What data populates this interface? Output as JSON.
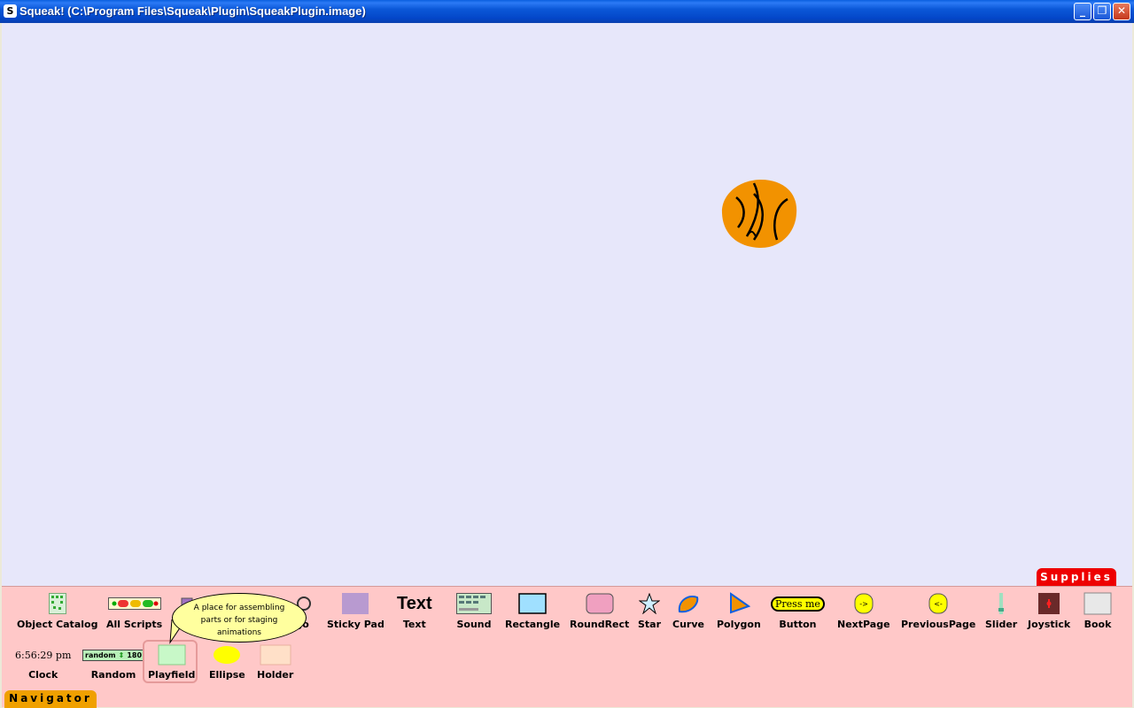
{
  "window": {
    "title": "Squeak! (C:\\Program Files\\Squeak\\Plugin\\SqueakPlugin.image)",
    "icon_glyph": "S",
    "controls": {
      "minimize": "_",
      "maximize": "❐",
      "close": "✕"
    }
  },
  "supplies_tab": {
    "label": "Supplies",
    "color": "#ee0000"
  },
  "navigator_tab": {
    "label": "Navigator",
    "color": "#f0a000"
  },
  "colors": {
    "world_bg": "#e7e7fa",
    "flap_bg": "#ffc8c8",
    "ball": "#f29200",
    "balloon": "#ffff9e"
  },
  "parts_row1": [
    {
      "label": "Object Catalog"
    },
    {
      "label": "All Scripts"
    },
    {
      "label": "To",
      "note": "partially hidden"
    },
    {
      "label": "Jo",
      "note": "partially hidden"
    },
    {
      "label": "Sticky Pad"
    },
    {
      "label": "Text",
      "thumb_text": "Text"
    },
    {
      "label": "Sound"
    },
    {
      "label": "Rectangle"
    },
    {
      "label": "RoundRect"
    },
    {
      "label": "Star"
    },
    {
      "label": "Curve"
    },
    {
      "label": "Polygon"
    },
    {
      "label": "Button",
      "thumb_text": "Press me"
    },
    {
      "label": "NextPage",
      "thumb_text": "->"
    },
    {
      "label": "PreviousPage",
      "thumb_text": "<-"
    },
    {
      "label": "Slider"
    },
    {
      "label": "Joystick"
    },
    {
      "label": "Book"
    }
  ],
  "parts_row2": [
    {
      "label": "Clock",
      "thumb_text": "6:56:29 pm"
    },
    {
      "label": "Random",
      "thumb_text": "random",
      "thumb_value": "180"
    },
    {
      "label": "Playfield"
    },
    {
      "label": "Ellipse"
    },
    {
      "label": "Holder"
    }
  ],
  "balloon": {
    "text": "A place for assembling parts or for staging animations"
  }
}
